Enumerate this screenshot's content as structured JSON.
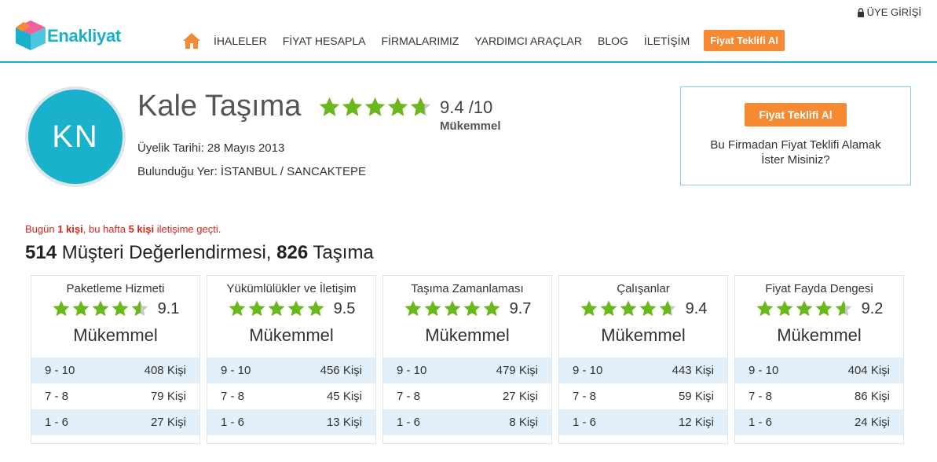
{
  "header": {
    "logo_text": "Enakliyat",
    "nav": [
      "İHALELER",
      "FİYAT HESAPLA",
      "FİRMALARIMIZ",
      "YARDIMCI ARAÇLAR",
      "BLOG",
      "İLETİŞİM"
    ],
    "cta_label": "Fiyat Teklifi Al",
    "login_label": "ÜYE GİRİŞİ",
    "icons": {
      "home": "home-icon",
      "lock": "lock-icon"
    },
    "accent_color": "#1ab1cc",
    "cta_color": "#f68a33"
  },
  "company": {
    "initials": "KN",
    "name": "Kale Taşıma",
    "rating_score": "9.4 /10",
    "rating_label": "Mükemmel",
    "rating_stars": 4.7,
    "member_since": "Üyelik Tarihi: 28 Mayıs 2013",
    "location": "Bulunduğu Yer: İSTANBUL / SANCAKTEPE"
  },
  "quote_box": {
    "button_label": "Fiyat Teklifi Al",
    "text": "Bu Firmadan Fiyat Teklifi Alamak İster Misiniz?"
  },
  "contact_note": {
    "p1": "Bugün ",
    "today_count": "1 kişi",
    "p2": ", bu hafta ",
    "week_count": "5 kişi",
    "p3": " iletişime geçti."
  },
  "summary": {
    "reviews_count": "514",
    "reviews_label": " Müşteri Değerlendirmesi, ",
    "moves_count": "826",
    "moves_label": " Taşıma"
  },
  "cards": [
    {
      "title": "Paketleme Hizmeti",
      "score": "9.1",
      "stars": 4.55,
      "label": "Mükemmel",
      "rows": [
        {
          "range": "9 - 10",
          "count": "408 Kişi"
        },
        {
          "range": "7 - 8",
          "count": "79 Kişi"
        },
        {
          "range": "1 - 6",
          "count": "27 Kişi"
        }
      ]
    },
    {
      "title": "Yükümlülükler ve İletişim",
      "score": "9.5",
      "stars": 5,
      "label": "Mükemmel",
      "rows": [
        {
          "range": "9 - 10",
          "count": "456 Kişi"
        },
        {
          "range": "7 - 8",
          "count": "45 Kişi"
        },
        {
          "range": "1 - 6",
          "count": "13 Kişi"
        }
      ]
    },
    {
      "title": "Taşıma Zamanlaması",
      "score": "9.7",
      "stars": 5,
      "label": "Mükemmel",
      "rows": [
        {
          "range": "9 - 10",
          "count": "479 Kişi"
        },
        {
          "range": "7 - 8",
          "count": "27 Kişi"
        },
        {
          "range": "1 - 6",
          "count": "8 Kişi"
        }
      ]
    },
    {
      "title": "Çalışanlar",
      "score": "9.4",
      "stars": 4.7,
      "label": "Mükemmel",
      "rows": [
        {
          "range": "9 - 10",
          "count": "443 Kişi"
        },
        {
          "range": "7 - 8",
          "count": "59 Kişi"
        },
        {
          "range": "1 - 6",
          "count": "12 Kişi"
        }
      ]
    },
    {
      "title": "Fiyat Fayda Dengesi",
      "score": "9.2",
      "stars": 4.6,
      "label": "Mükemmel",
      "rows": [
        {
          "range": "9 - 10",
          "count": "404 Kişi"
        },
        {
          "range": "7 - 8",
          "count": "86 Kişi"
        },
        {
          "range": "1 - 6",
          "count": "24 Kişi"
        }
      ]
    }
  ],
  "colors": {
    "star_fill": "#6ab81e",
    "star_empty": "#c8c8c8",
    "row_shade": "#e3f0fa",
    "note_red": "#d9261c"
  }
}
